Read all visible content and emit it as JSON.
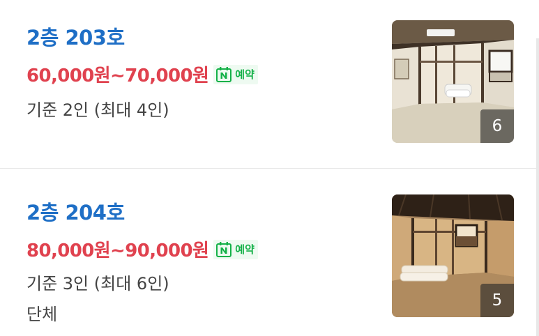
{
  "rooms": [
    {
      "name": "2층 203호",
      "price": "60,000원~70,000원",
      "booking_badge": {
        "icon": "naver-n-calendar-icon",
        "label": "예약"
      },
      "capacity": "기준 2인 (최대 4인)",
      "photo_count": "6"
    },
    {
      "name": "2층 204호",
      "price": "80,000원~90,000원",
      "booking_badge": {
        "icon": "naver-n-calendar-icon",
        "label": "예약"
      },
      "capacity": "기준 3인 (최대 6인)",
      "note": "단체",
      "photo_count": "5"
    }
  ],
  "colors": {
    "room_name": "#1f6fc6",
    "price": "#e0424f",
    "booking_green": "#14b148",
    "text": "#444444"
  }
}
